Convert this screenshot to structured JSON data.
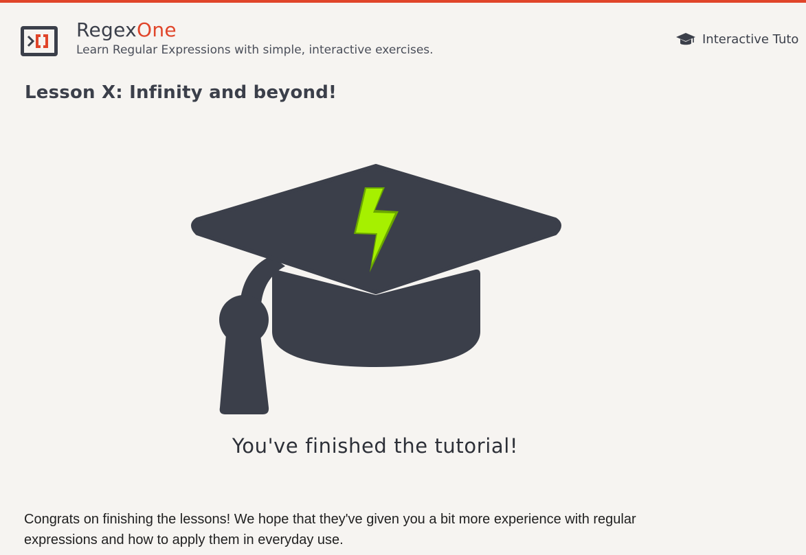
{
  "colors": {
    "accent": "#e0452a",
    "text_dark": "#3b3f4a",
    "background": "#f6f4f1",
    "bolt_light": "#a6f000",
    "bolt_dark": "#6aa600"
  },
  "header": {
    "logo_icon": "regex-bracket-icon",
    "brand_part1": "Regex",
    "brand_part2": "One",
    "tagline": "Learn Regular Expressions with simple, interactive exercises.",
    "nav": {
      "icon": "graduation-cap-icon",
      "label": "Interactive Tuto"
    }
  },
  "lesson": {
    "title": "Lesson X: Infinity and beyond!",
    "illustration_icon": "graduation-cap-lightning-icon",
    "finished_message": "You've finished the tutorial!",
    "congrats_text": "Congrats on finishing the lessons! We hope that they've given you a bit more experience with regular expressions and how to apply them in everyday use."
  }
}
